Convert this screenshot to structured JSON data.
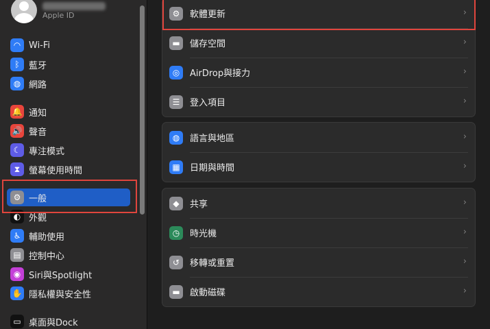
{
  "account": {
    "subtitle": "Apple ID"
  },
  "sidebar": {
    "items": [
      {
        "label": "Wi-Fi",
        "icon": "wifi-icon",
        "glyph": "◠",
        "color": "#2f7cf6"
      },
      {
        "label": "藍牙",
        "icon": "bluetooth-icon",
        "glyph": "ᛒ",
        "color": "#2f7cf6"
      },
      {
        "label": "網路",
        "icon": "globe-icon",
        "glyph": "◍",
        "color": "#2f7cf6"
      },
      {
        "label": "通知",
        "icon": "bell-icon",
        "glyph": "🔔",
        "color": "#e8453c"
      },
      {
        "label": "聲音",
        "icon": "speaker-icon",
        "glyph": "🔊",
        "color": "#e8453c"
      },
      {
        "label": "專注模式",
        "icon": "moon-icon",
        "glyph": "☾",
        "color": "#5e5ce6"
      },
      {
        "label": "螢幕使用時間",
        "icon": "hourglass-icon",
        "glyph": "⧗",
        "color": "#5e5ce6"
      },
      {
        "label": "一般",
        "icon": "gear-icon",
        "glyph": "⚙",
        "color": "#8e8e93"
      },
      {
        "label": "外觀",
        "icon": "appearance-icon",
        "glyph": "◐",
        "color": "#111111"
      },
      {
        "label": "輔助使用",
        "icon": "accessibility-icon",
        "glyph": "♿",
        "color": "#2f7cf6"
      },
      {
        "label": "控制中心",
        "icon": "control-center-icon",
        "glyph": "▤",
        "color": "#8e8e93"
      },
      {
        "label": "Siri與Spotlight",
        "icon": "siri-icon",
        "glyph": "◉",
        "color": "#c43fd8"
      },
      {
        "label": "隱私權與安全性",
        "icon": "hand-icon",
        "glyph": "✋",
        "color": "#2f7cf6"
      },
      {
        "label": "桌面與Dock",
        "icon": "dock-icon",
        "glyph": "▭",
        "color": "#111111"
      }
    ]
  },
  "main": {
    "groups": [
      {
        "rows": [
          {
            "label": "軟體更新",
            "icon": "software-update-icon",
            "glyph": "⚙",
            "color": "#8e8e93"
          },
          {
            "label": "儲存空間",
            "icon": "storage-icon",
            "glyph": "▬",
            "color": "#8e8e93"
          },
          {
            "label": "AirDrop與接力",
            "icon": "airdrop-icon",
            "glyph": "◎",
            "color": "#2f7cf6"
          },
          {
            "label": "登入項目",
            "icon": "list-icon",
            "glyph": "☰",
            "color": "#8e8e93"
          }
        ]
      },
      {
        "rows": [
          {
            "label": "語言與地區",
            "icon": "globe-icon",
            "glyph": "◍",
            "color": "#2f7cf6"
          },
          {
            "label": "日期與時間",
            "icon": "calendar-icon",
            "glyph": "▦",
            "color": "#2f7cf6"
          }
        ]
      },
      {
        "rows": [
          {
            "label": "共享",
            "icon": "share-icon",
            "glyph": "◆",
            "color": "#8e8e93"
          },
          {
            "label": "時光機",
            "icon": "time-machine-icon",
            "glyph": "◷",
            "color": "#2c8a5a"
          },
          {
            "label": "移轉或重置",
            "icon": "reset-icon",
            "glyph": "↺",
            "color": "#8e8e93"
          },
          {
            "label": "啟動磁碟",
            "icon": "disk-icon",
            "glyph": "▬",
            "color": "#8e8e93"
          }
        ]
      }
    ],
    "chevron": "›"
  },
  "colors": {
    "accent": "#1f5ec6",
    "highlight": "#e1453d"
  }
}
